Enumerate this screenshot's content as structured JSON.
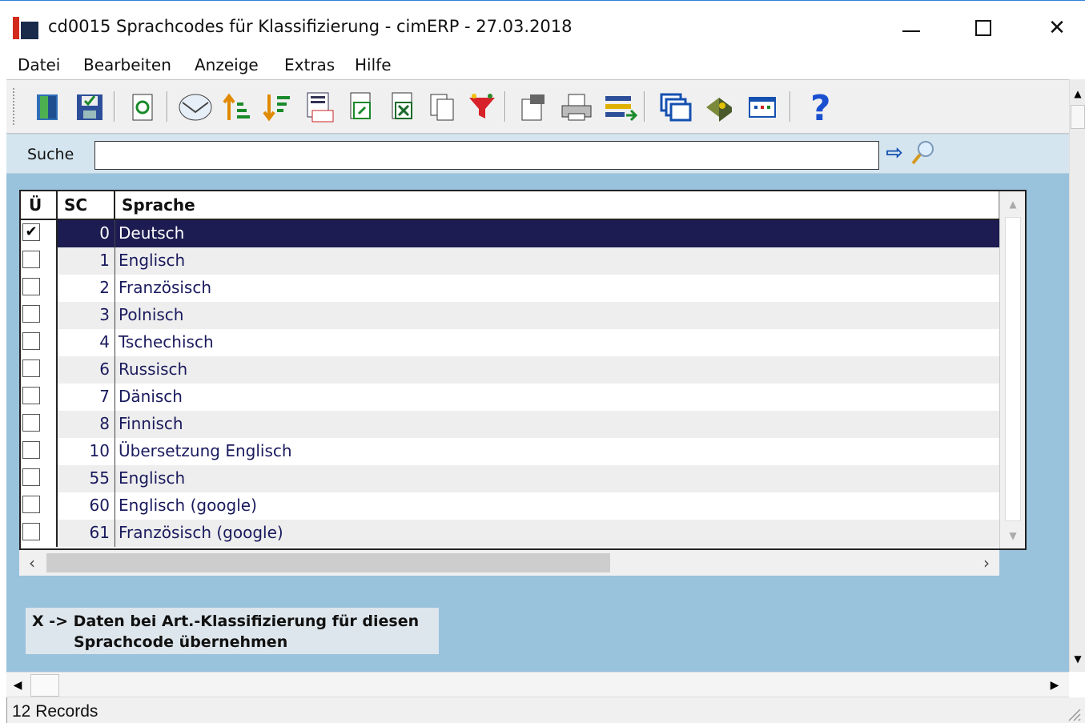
{
  "window": {
    "title": "cd0015 Sprachcodes für Klassifizierung - cimERP - 27.03.2018",
    "minimize": "",
    "maximize": "",
    "close": "✕"
  },
  "menu": [
    "Datei",
    "Bearbeiten",
    "Anzeige",
    "Extras",
    "Hilfe"
  ],
  "toolbar": {
    "icons": [
      "exit-door-icon",
      "save-icon",
      "refresh-icon",
      "email-icon",
      "sort-ascending-icon",
      "sort-descending-icon",
      "numbering-icon",
      "export-icon",
      "excel-export-icon",
      "copy-icon",
      "filter-icon",
      "properties-icon",
      "print-icon",
      "transfer-icon",
      "windows-icon",
      "book-icon",
      "table-view-icon",
      "help-icon"
    ]
  },
  "search": {
    "label": "Suche",
    "value": "",
    "go": "⇨"
  },
  "grid": {
    "headers": {
      "check": "Ü",
      "sc": "SC",
      "lang": "Sprache"
    },
    "rows": [
      {
        "checked": true,
        "sc": "0",
        "lang": "Deutsch",
        "selected": true
      },
      {
        "checked": false,
        "sc": "1",
        "lang": "Englisch"
      },
      {
        "checked": false,
        "sc": "2",
        "lang": "Französisch"
      },
      {
        "checked": false,
        "sc": "3",
        "lang": "Polnisch"
      },
      {
        "checked": false,
        "sc": "4",
        "lang": "Tschechisch"
      },
      {
        "checked": false,
        "sc": "6",
        "lang": "Russisch"
      },
      {
        "checked": false,
        "sc": "7",
        "lang": "Dänisch"
      },
      {
        "checked": false,
        "sc": "8",
        "lang": "Finnisch"
      },
      {
        "checked": false,
        "sc": "10",
        "lang": "Übersetzung Englisch"
      },
      {
        "checked": false,
        "sc": "55",
        "lang": "Englisch"
      },
      {
        "checked": false,
        "sc": "60",
        "lang": "Englisch (google)"
      },
      {
        "checked": false,
        "sc": "61",
        "lang": "Französisch (google)"
      }
    ]
  },
  "legend": {
    "line1": "X -> Daten bei Art.-Klassifizierung für diesen",
    "line2": "Sprachcode übernehmen"
  },
  "status": {
    "records": "12 Records"
  },
  "colors": {
    "client_bg": "#99c2dd",
    "selected_row": "#1c1c52",
    "row_text": "#1a1a5e"
  }
}
